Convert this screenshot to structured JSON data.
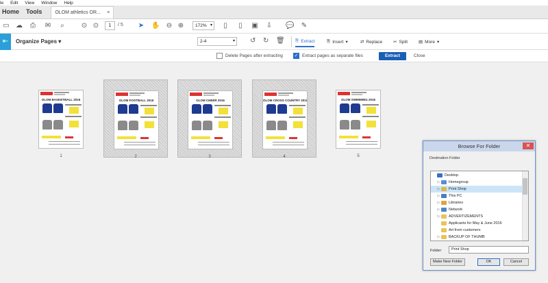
{
  "menu": [
    "le",
    "Edit",
    "View",
    "Window",
    "Help"
  ],
  "nav": {
    "home": "Home",
    "tools": "Tools",
    "doc_tab": "OLOM athletics OR...",
    "doc_close": "×"
  },
  "toolbar": {
    "page_current": "1",
    "page_total": "/ 5",
    "zoom": "172%"
  },
  "org": {
    "title": "Organize Pages",
    "range": "2-4",
    "extract": "Extract",
    "insert": "Insert",
    "replace": "Replace",
    "split": "Split",
    "more": "More"
  },
  "sub": {
    "delete_after": "Delete Pages after extracting",
    "separate_files": "Extract pages as separate files",
    "extract_btn": "Extract",
    "close": "Close"
  },
  "pages": [
    {
      "num": "1",
      "title": "OLOM BASKETBALL 2016",
      "selected": false
    },
    {
      "num": "2",
      "title": "OLOM FOOTBALL 2016",
      "selected": true
    },
    {
      "num": "3",
      "title": "OLOM CHEER 2016",
      "selected": true
    },
    {
      "num": "4",
      "title": "OLOM CROSS COUNTRY 2016",
      "selected": true
    },
    {
      "num": "5",
      "title": "OLOM SWIMMING 2016",
      "selected": false
    }
  ],
  "dialog": {
    "title": "Browse For Folder",
    "close": "✕",
    "label": "Destination Folder",
    "tree": [
      {
        "label": "Desktop",
        "icon": "desktop",
        "indent": 0,
        "arrow": ""
      },
      {
        "label": "Homegroup",
        "icon": "homegroup",
        "indent": 1,
        "arrow": "▷"
      },
      {
        "label": "Print Shop",
        "icon": "user-folder",
        "indent": 1,
        "arrow": "▷",
        "selected": true
      },
      {
        "label": "This PC",
        "icon": "pc",
        "indent": 1,
        "arrow": "▷"
      },
      {
        "label": "Libraries",
        "icon": "libraries",
        "indent": 1,
        "arrow": "▷"
      },
      {
        "label": "Network",
        "icon": "network",
        "indent": 1,
        "arrow": "▷"
      },
      {
        "label": "ADVERTIZEMENTS",
        "icon": "folder",
        "indent": 1,
        "arrow": "▷"
      },
      {
        "label": "Applicants for May & June 2016",
        "icon": "folder",
        "indent": 1,
        "arrow": ""
      },
      {
        "label": "Art from customers",
        "icon": "folder",
        "indent": 1,
        "arrow": ""
      },
      {
        "label": "BACKUP OF THUMB",
        "icon": "folder",
        "indent": 1,
        "arrow": "▷"
      }
    ],
    "folder_label": "Folder:",
    "folder_value": "Print Shop",
    "new_folder": "Make New Folder",
    "ok": "OK",
    "cancel": "Cancel"
  },
  "colors": {
    "accent": "#2a6fc9",
    "extract_btn": "#1b5fb4",
    "org_icon": "#2a9fd8",
    "shirt_blue": "#1e3b8f",
    "yellow": "#f2e13a"
  }
}
